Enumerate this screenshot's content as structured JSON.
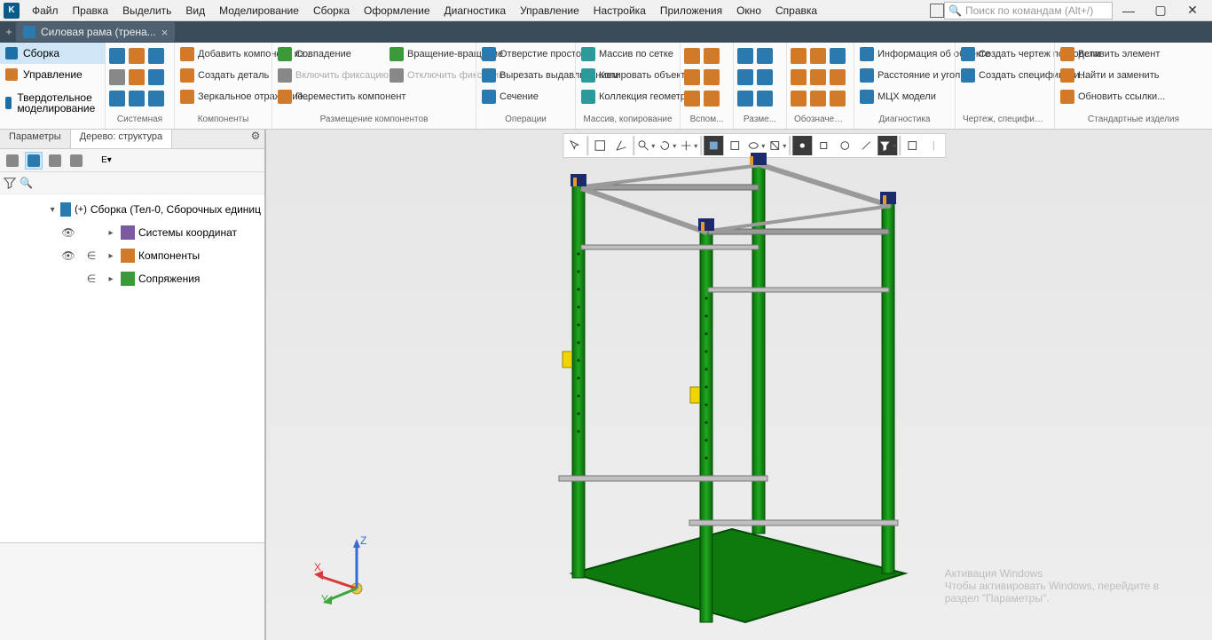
{
  "menu": {
    "items": [
      "Файл",
      "Правка",
      "Выделить",
      "Вид",
      "Моделирование",
      "Сборка",
      "Оформление",
      "Диагностика",
      "Управление",
      "Настройка",
      "Приложения",
      "Окно",
      "Справка"
    ]
  },
  "search": {
    "placeholder": "Поиск по командам (Alt+/)"
  },
  "tab": {
    "title": "Силовая рама (трена...",
    "close": "×"
  },
  "side_ribbon": {
    "items": [
      "Сборка",
      "Управление",
      "Твердотельное моделирование"
    ],
    "active": 0
  },
  "ribbon": {
    "groups": [
      {
        "title": "Системная"
      },
      {
        "title": "Компоненты",
        "cmds": [
          "Добавить компонент из...",
          "Создать деталь",
          "Зеркальное отражение..."
        ]
      },
      {
        "title": "Размещение компонентов",
        "cmds": [
          "Совпадение",
          "Включить фиксацию",
          "Переместить компонент",
          "Вращение-вращение",
          "Отключить фиксацию"
        ]
      },
      {
        "title": "Операции",
        "cmds": [
          "Отверстие простое",
          "Вырезать выдавливанием",
          "Сечение"
        ]
      },
      {
        "title": "Массив, копирование",
        "cmds": [
          "Массив по сетке",
          "Копировать объекты",
          "Коллекция геометрии"
        ]
      },
      {
        "title": "Вспом..."
      },
      {
        "title": "Разме..."
      },
      {
        "title": "Обозначения"
      },
      {
        "title": "Диагностика",
        "cmds": [
          "Информация об объекте",
          "Расстояние и угол",
          "МЦХ модели"
        ]
      },
      {
        "title": "Чертеж, спецификац...",
        "cmds": [
          "Создать чертеж по модели",
          "Создать спецификаци..."
        ]
      },
      {
        "title": "Стандартные изделия",
        "cmds": [
          "Вставить элемент",
          "Найти и заменить",
          "Обновить ссылки..."
        ]
      }
    ]
  },
  "left_panel": {
    "tabs": [
      "Параметры",
      "Дерево: структура"
    ],
    "active_tab": 1,
    "tree": {
      "root": "Сборка (Тел-0, Сборочных единиц",
      "children": [
        "Системы координат",
        "Компоненты",
        "Сопряжения"
      ]
    }
  },
  "watermark": {
    "title": "Активация Windows",
    "sub1": "Чтобы активировать Windows, перейдите в",
    "sub2": "раздел \"Параметры\"."
  }
}
